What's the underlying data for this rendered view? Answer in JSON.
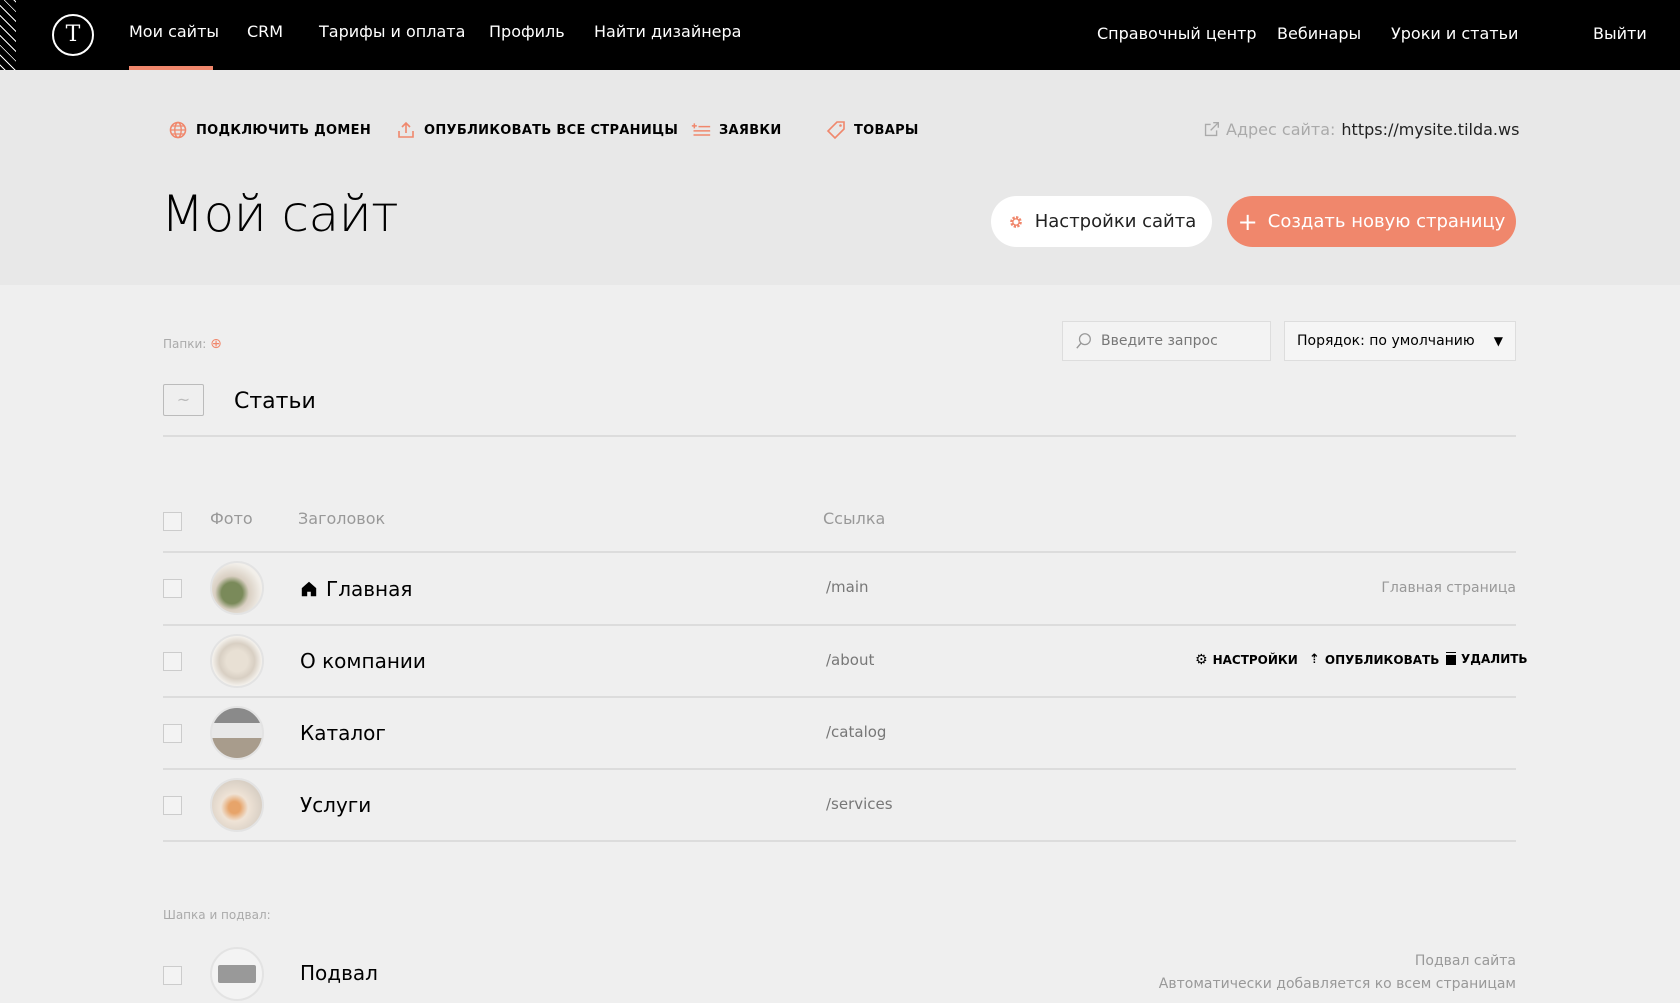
{
  "nav": {
    "items": [
      "Мои сайты",
      "CRM",
      "Тарифы и оплата",
      "Профиль",
      "Найти дизайнера"
    ],
    "right": [
      "Справочный центр",
      "Вебинары",
      "Уроки и статьи"
    ],
    "logout": "Выйти",
    "logo": "T"
  },
  "toolbar": {
    "domain": "ПОДКЛЮЧИТЬ ДОМЕН",
    "publish_all": "ОПУБЛИКОВАТЬ ВСЕ СТРАНИЦЫ",
    "leads": "ЗАЯВКИ",
    "products": "ТОВАРЫ",
    "address_label": "Адрес сайта:",
    "address": "https://mysite.tilda.ws"
  },
  "page": {
    "title": "Мой сайт",
    "settings_button": "Настройки сайта",
    "create_button": "Создать новую страницу"
  },
  "folders": {
    "label": "Папки:",
    "items": [
      "Статьи"
    ]
  },
  "search": {
    "placeholder": "Введите запрос"
  },
  "sort": {
    "value": "Порядок: по умолчанию"
  },
  "table": {
    "headers": {
      "photo": "Фото",
      "title": "Заголовок",
      "link": "Ссылка"
    },
    "rows": [
      {
        "title": "Главная",
        "link": "/main",
        "note": "Главная страница"
      },
      {
        "title": "О компании",
        "link": "/about"
      },
      {
        "title": "Каталог",
        "link": "/catalog"
      },
      {
        "title": "Услуги",
        "link": "/services"
      }
    ],
    "actions": {
      "settings": "НАСТРОЙКИ",
      "publish": "ОПУБЛИКОВАТЬ",
      "delete": "УДАЛИТЬ"
    }
  },
  "header_footer": {
    "label": "Шапка и подвал:",
    "title": "Подвал",
    "note1": "Подвал сайта",
    "note2": "Автоматически добавляется ко всем страницам"
  },
  "colors": {
    "accent": "#f0876c",
    "nav_bg": "#000000",
    "header_bg": "#e8e8e8",
    "page_bg": "#efefef"
  }
}
